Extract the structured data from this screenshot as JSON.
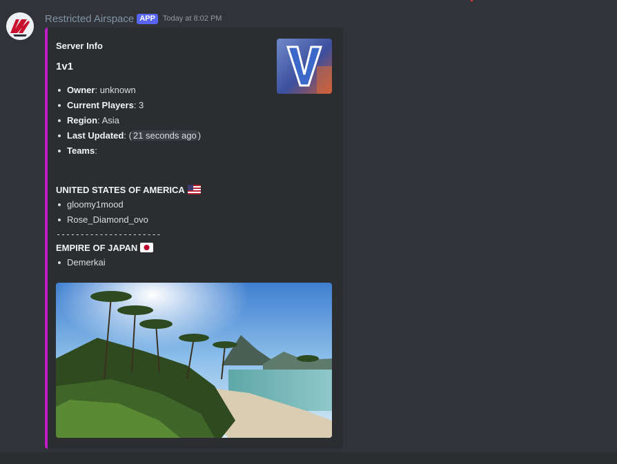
{
  "message": {
    "author": "Restricted Airspace",
    "badge": "APP",
    "timestamp": "Today at 8:02 PM"
  },
  "embed": {
    "accent_color": "#c21cc8",
    "author": "Server Info",
    "title": "1v1",
    "fields": [
      {
        "key": "Owner",
        "value": ": unknown"
      },
      {
        "key": "Current Players",
        "value": ": 3"
      },
      {
        "key": "Region",
        "value": ": Asia"
      },
      {
        "key": "Last Updated",
        "value_prefix": ": (",
        "value_chip": "21 seconds ago",
        "value_suffix": ")"
      },
      {
        "key": "Teams",
        "value": ":"
      }
    ],
    "teams": [
      {
        "name": "UNITED STATES OF AMERICA",
        "flag": "flag-us-icon",
        "players": [
          "gloomy1mood",
          "Rose_Diamond_ovo"
        ]
      },
      {
        "name": "EMPIRE OF JAPAN",
        "flag": "flag-jp-icon",
        "players": [
          "Demerkai"
        ]
      }
    ],
    "divider": "----------------------",
    "thumbnail_icon": "battlefield-v-logo",
    "image_icon": "tropical-beach-landscape"
  }
}
